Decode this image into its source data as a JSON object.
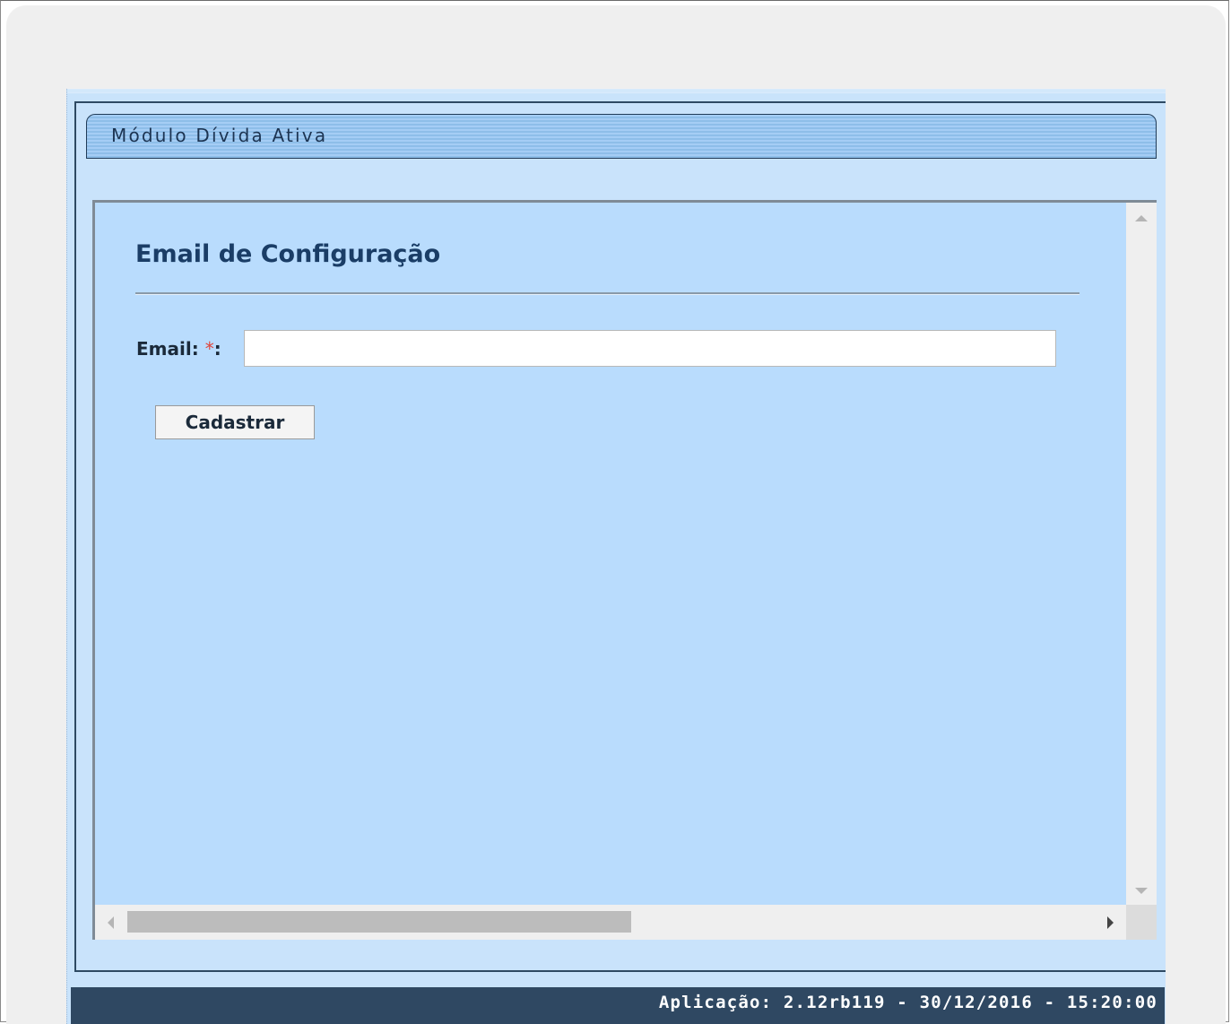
{
  "header": {
    "module_title": "Módulo Dívida Ativa"
  },
  "form": {
    "title": "Email de Configuração",
    "email_label": "Email:",
    "required_marker": "*",
    "label_colon": ":",
    "email_value": "",
    "email_placeholder": "",
    "submit_label": "Cadastrar"
  },
  "footer": {
    "app_info": "Aplicação: 2.12rb119 - 30/12/2016 - 15:20:00"
  },
  "colors": {
    "module_bar": "#8ebee9",
    "content_background": "#b9dcfd",
    "footer_background": "#2f4862",
    "required_marker": "#e0453a"
  },
  "icons": {
    "scroll_up": "triangle-up",
    "scroll_down": "triangle-down",
    "scroll_left": "triangle-left",
    "scroll_right": "triangle-right"
  }
}
